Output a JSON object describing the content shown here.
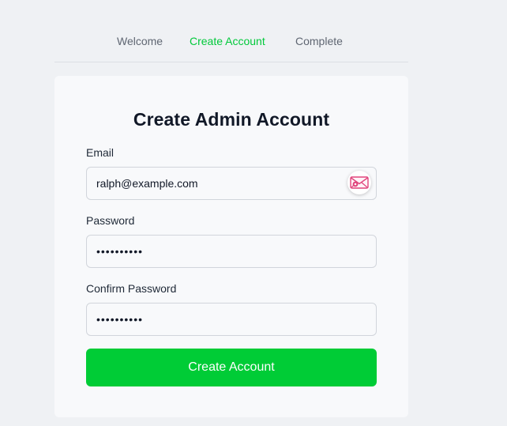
{
  "steps": [
    {
      "label": "Welcome",
      "active": false
    },
    {
      "label": "Create Account",
      "active": true
    },
    {
      "label": "Complete",
      "active": false
    }
  ],
  "form": {
    "title": "Create Admin Account",
    "email_label": "Email",
    "email_value": "ralph@example.com",
    "password_label": "Password",
    "password_value": "••••••••••",
    "confirm_label": "Confirm Password",
    "confirm_value": "••••••••••",
    "submit_label": "Create Account",
    "email_icon": "email-autofill-icon"
  },
  "colors": {
    "accent": "#00cc36",
    "active_step": "#00c93a",
    "background": "#eff1f4",
    "card": "#f8f9fb",
    "icon_pink": "#e0447c"
  }
}
